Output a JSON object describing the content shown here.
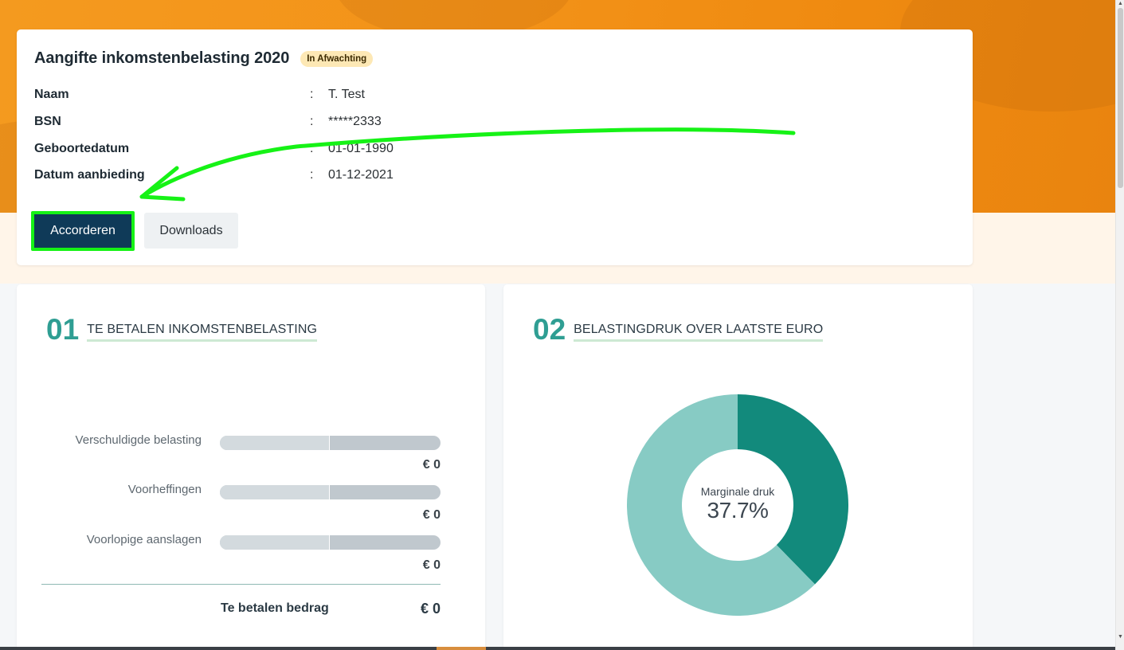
{
  "declaration": {
    "title": "Aangifte inkomstenbelasting 2020",
    "status": "In Afwachting",
    "fields": [
      {
        "label": "Naam",
        "value": "T. Test"
      },
      {
        "label": "BSN",
        "value": "*****2333"
      },
      {
        "label": "Geboortedatum",
        "value": "01-01-1990"
      },
      {
        "label": "Datum aanbieding",
        "value": "01-12-2021"
      }
    ],
    "separator": ":",
    "buttons": {
      "approve": "Accorderen",
      "downloads": "Downloads"
    }
  },
  "card1": {
    "number": "01",
    "title": "TE BETALEN INKOMSTENBELASTING",
    "rows": [
      {
        "label": "Verschuldigde belasting",
        "amount": "€ 0"
      },
      {
        "label": "Voorheffingen",
        "amount": "€ 0"
      },
      {
        "label": "Voorlopige aanslagen",
        "amount": "€ 0"
      }
    ],
    "total_label": "Te betalen bedrag",
    "total_amount": "€ 0"
  },
  "card2": {
    "number": "02",
    "title": "BELASTINGDRUK OVER LAATSTE EURO",
    "center_label": "Marginale druk",
    "center_value": "37.7%"
  },
  "chart_data": {
    "type": "pie",
    "categories": [
      "Marginale druk",
      ""
    ],
    "values": [
      37.7,
      62.3
    ],
    "colors": [
      "#128a7c",
      "#87cbc4"
    ]
  },
  "colors": {
    "accent_teal": "#2f9e93",
    "primary_button": "#0f3a58",
    "annotation_green": "#16f216",
    "hero_orange": "#f39218"
  }
}
